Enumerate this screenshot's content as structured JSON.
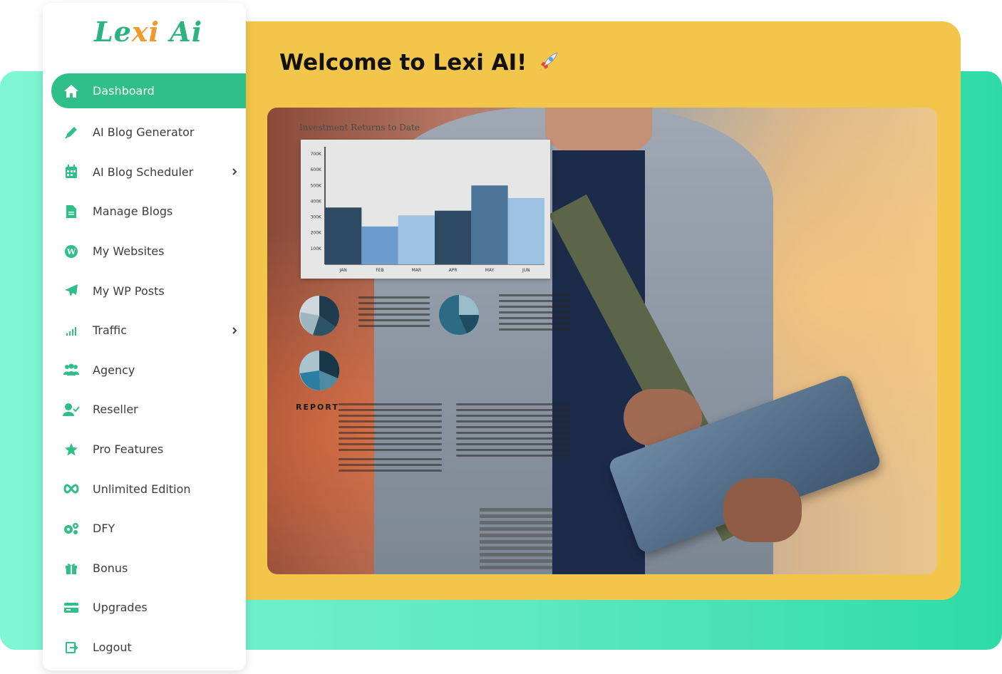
{
  "brand": {
    "logo_part1": "Le",
    "logo_part2": "xi",
    "logo_part3": " Ai"
  },
  "header": {
    "welcome": "Welcome to Lexi AI!"
  },
  "sidebar": {
    "items": [
      {
        "label": "Dashboard",
        "icon": "home-icon",
        "active": true
      },
      {
        "label": "AI Blog Generator",
        "icon": "pen-icon"
      },
      {
        "label": "AI Blog Scheduler",
        "icon": "calendar-icon",
        "has_submenu": true
      },
      {
        "label": "Manage Blogs",
        "icon": "document-icon"
      },
      {
        "label": "My Websites",
        "icon": "wordpress-icon"
      },
      {
        "label": "My WP Posts",
        "icon": "paper-plane-icon"
      },
      {
        "label": "Traffic",
        "icon": "signal-bars-icon",
        "has_submenu": true
      },
      {
        "label": "Agency",
        "icon": "users-icon"
      },
      {
        "label": "Reseller",
        "icon": "user-check-icon"
      },
      {
        "label": "Pro Features",
        "icon": "star-icon"
      },
      {
        "label": "Unlimited Edition",
        "icon": "infinity-icon"
      },
      {
        "label": "DFY",
        "icon": "gears-icon"
      },
      {
        "label": "Bonus",
        "icon": "gift-icon"
      },
      {
        "label": "Upgrades",
        "icon": "credit-card-icon"
      },
      {
        "label": "Logout",
        "icon": "logout-icon"
      }
    ]
  },
  "hero": {
    "chart_title": "Investment Returns to Date",
    "report_label": "REPORT",
    "chart": {
      "categories": [
        "JAN",
        "FEB",
        "MAR",
        "APR",
        "MAY",
        "JUN"
      ],
      "values": [
        360000,
        240000,
        310000,
        340000,
        500000,
        420000
      ],
      "yticks": [
        "700K",
        "600K",
        "500K",
        "400K",
        "300K",
        "200K",
        "100K"
      ],
      "colors": [
        "#2e4a63",
        "#6a9dcc",
        "#9cc1e2",
        "#2e4a63",
        "#4c7499",
        "#9cc1e2"
      ]
    }
  },
  "colors": {
    "accent": "#2fbf89",
    "panel": "#f2c64a"
  }
}
